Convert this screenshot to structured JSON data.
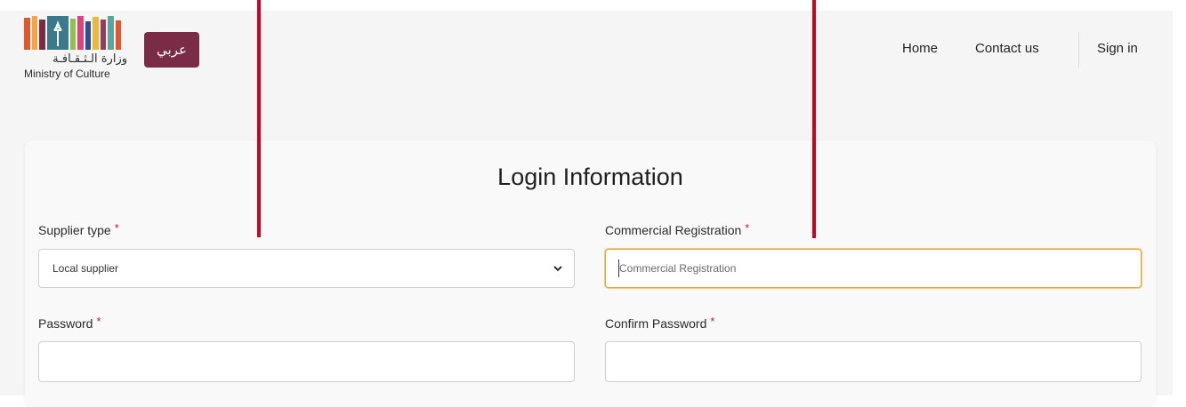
{
  "header": {
    "logo_arabic": "وزارة الـثـقـافـة",
    "logo_english": "Ministry of Culture",
    "language_button": "عربي",
    "nav": {
      "home": "Home",
      "contact": "Contact us",
      "sign_in": "Sign in"
    }
  },
  "form": {
    "title": "Login Information",
    "required_mark": "*",
    "supplier_type": {
      "label": "Supplier type",
      "value": "Local supplier"
    },
    "commercial_registration": {
      "label": "Commercial Registration",
      "placeholder": "Commercial Registration"
    },
    "password": {
      "label": "Password",
      "value": ""
    },
    "confirm_password": {
      "label": "Confirm Password",
      "value": ""
    }
  },
  "colors": {
    "brand": "#7a2b45",
    "required": "#c0203a",
    "focus_border": "#f0a33a",
    "annotation": "#d1001f"
  },
  "icons": {
    "select_arrow": "chevron-down-icon"
  }
}
